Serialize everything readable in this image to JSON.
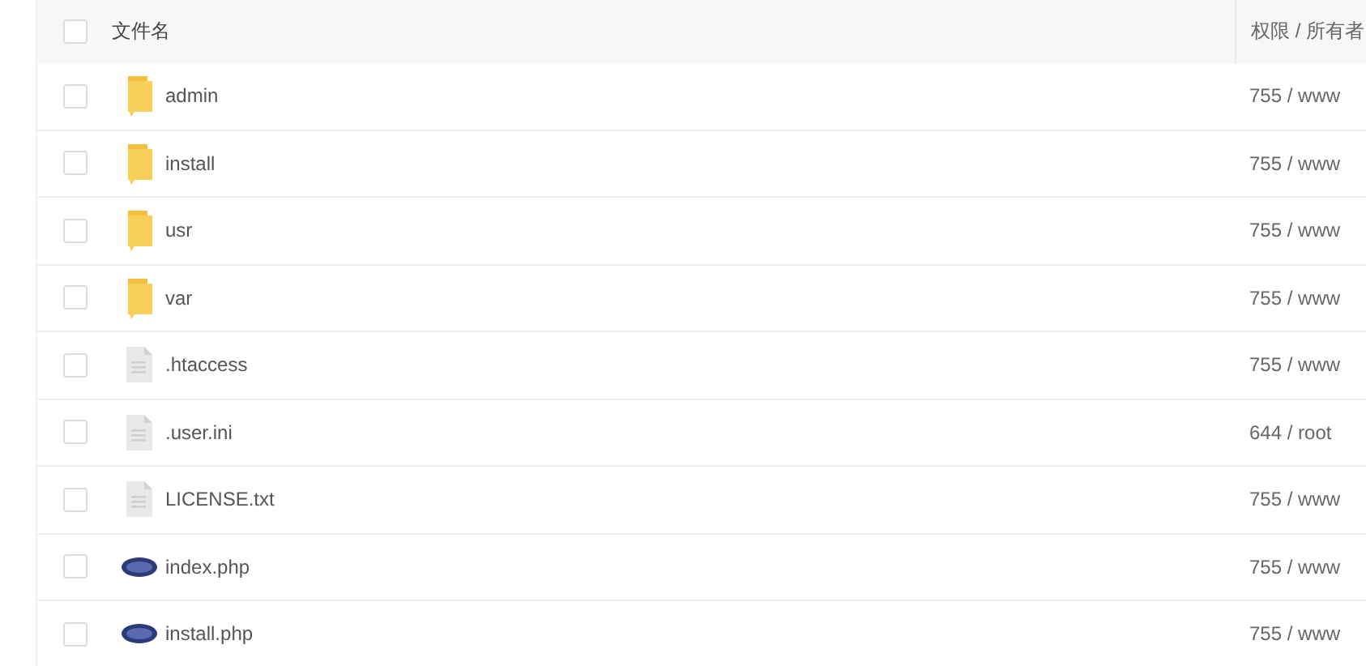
{
  "table": {
    "columns": [
      "文件名",
      "权限 / 所有者"
    ],
    "header_checked": false,
    "rows": [
      {
        "kind": "folder",
        "name": "admin",
        "permission": "755 / www",
        "checked": false
      },
      {
        "kind": "folder",
        "name": "install",
        "permission": "755 / www",
        "checked": false
      },
      {
        "kind": "folder",
        "name": "usr",
        "permission": "755 / www",
        "checked": false
      },
      {
        "kind": "folder",
        "name": "var",
        "permission": "755 / www",
        "checked": false
      },
      {
        "kind": "file",
        "name": ".htaccess",
        "permission": "755 / www",
        "checked": false
      },
      {
        "kind": "file",
        "name": ".user.ini",
        "permission": "644 / root",
        "checked": false
      },
      {
        "kind": "file",
        "name": "LICENSE.txt",
        "permission": "755 / www",
        "checked": false
      },
      {
        "kind": "php",
        "name": "index.php",
        "permission": "755 / www",
        "checked": false
      },
      {
        "kind": "php",
        "name": "install.php",
        "permission": "755 / www",
        "checked": false
      }
    ]
  }
}
